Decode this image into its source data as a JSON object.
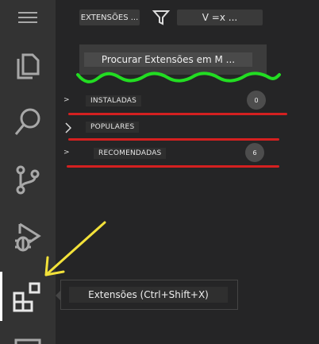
{
  "activity_bar": {
    "icons": [
      "menu-icon",
      "files-icon",
      "search-icon",
      "source-control-icon",
      "run-debug-icon",
      "extensions-icon",
      "remote-icon"
    ]
  },
  "toolbar": {
    "extensions_label": "EXTENSÕES ...",
    "filter_icon": "filter-icon",
    "view_label": "V =x ..."
  },
  "search": {
    "placeholder": "Procurar Extensões em M ..."
  },
  "sections": [
    {
      "chevron": ">",
      "label": "INSTALADAS",
      "count": "0"
    },
    {
      "chevron": ">",
      "label": "POPULARES"
    },
    {
      "chevron": ">",
      "label": "RECOMENDADAS",
      "count": "6"
    }
  ],
  "tooltip": {
    "text": "Extensões (Ctrl+Shift+X)"
  },
  "annotation_colors": {
    "green": "#22dd22",
    "red": "#d42020",
    "yellow": "#f3e23a"
  }
}
